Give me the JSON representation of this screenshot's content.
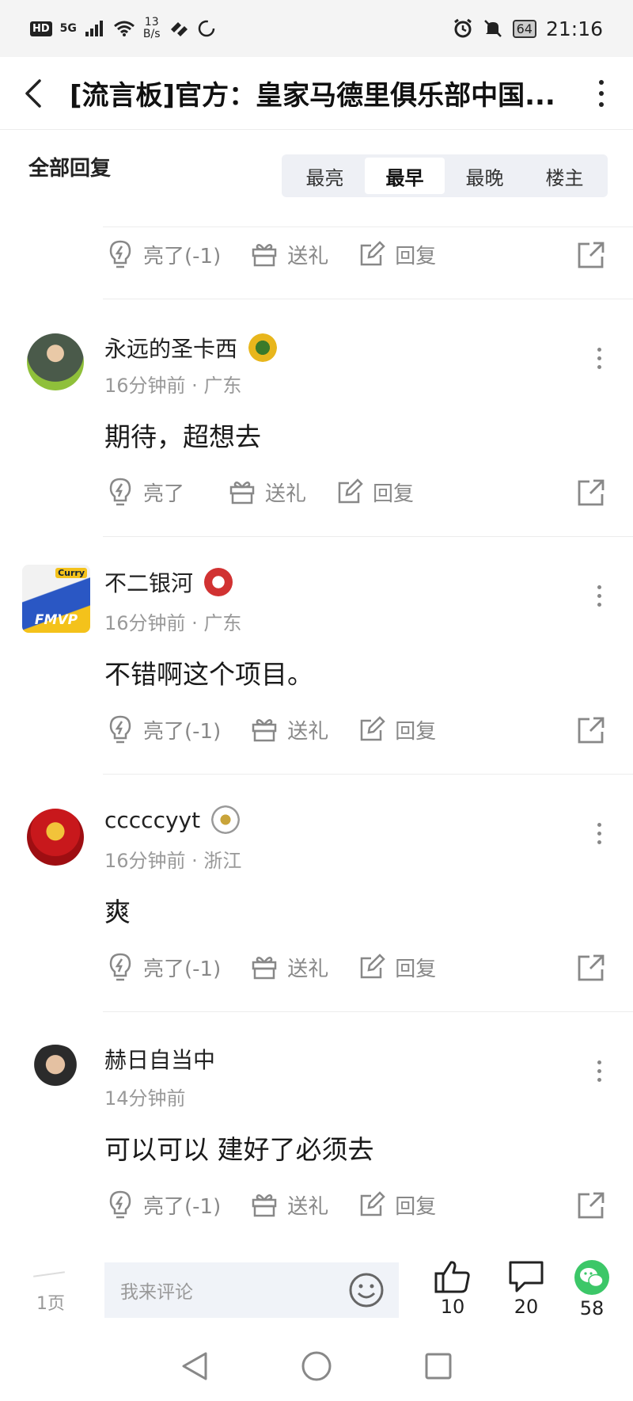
{
  "status_bar": {
    "network": "HD",
    "signal": "5G",
    "net_speed_value": "13",
    "net_speed_unit": "B/s",
    "battery": "64",
    "time": "21:16"
  },
  "header": {
    "title": "[流言板]官方：皇家马德里俱乐部中国..."
  },
  "filter": {
    "all_label": "全部回复",
    "tabs": [
      "最亮",
      "最早",
      "最晚",
      "楼主"
    ],
    "active_tab": "最早"
  },
  "top_actions": {
    "like": "亮了(-1)",
    "gift": "送礼",
    "reply": "回复"
  },
  "comments": [
    {
      "username": "永远的圣卡西",
      "meta": "16分钟前 · 广东",
      "text": "期待，超想去",
      "like": "亮了",
      "gift": "送礼",
      "reply": "回复"
    },
    {
      "username": "不二银河",
      "meta": "16分钟前 · 广东",
      "text": "不错啊这个项目。",
      "like": "亮了(-1)",
      "gift": "送礼",
      "reply": "回复",
      "avatar_text": "FMVP",
      "avatar_tag": "Curry"
    },
    {
      "username": "cccccyyt",
      "meta": "16分钟前 · 浙江",
      "text": "爽",
      "like": "亮了(-1)",
      "gift": "送礼",
      "reply": "回复"
    },
    {
      "username": "赫日自当中",
      "meta": "14分钟前",
      "text": "可以可以 建好了必须去",
      "like": "亮了(-1)",
      "gift": "送礼",
      "reply": "回复"
    }
  ],
  "bottom_bar": {
    "page": "1页",
    "comment_placeholder": "我来评论",
    "likes": "10",
    "comments": "20",
    "shares": "58"
  },
  "colors": {
    "accent_green": "#3cc768",
    "icon_gray": "#888888",
    "tab_bg": "#eef0f5"
  }
}
